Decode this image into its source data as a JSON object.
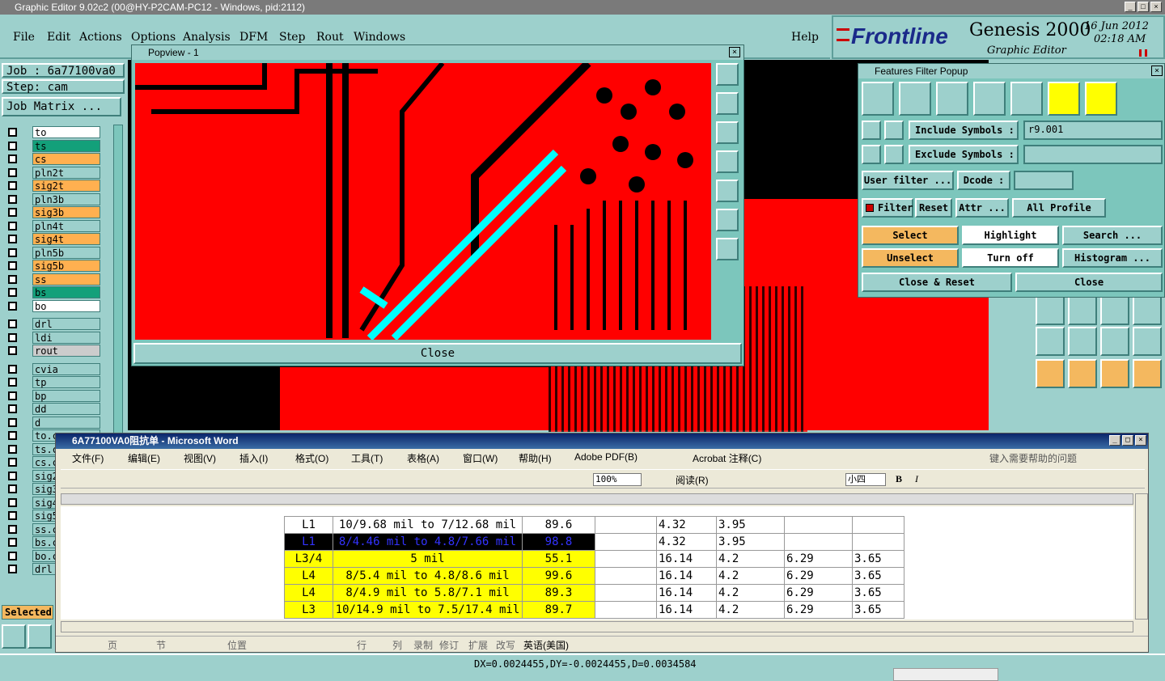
{
  "window": {
    "title": "Graphic Editor 9.02c2 (00@HY-P2CAM-PC12 - Windows, pid:2112)"
  },
  "menu": [
    "File",
    "Edit",
    "Actions",
    "Options",
    "Analysis",
    "DFM",
    "Step",
    "Rout",
    "Windows"
  ],
  "help": "Help",
  "logo": {
    "brand": "Frontline",
    "product": "Genesis 2000",
    "subtitle": "Graphic Editor",
    "date": "16 Jun 2012",
    "time": "02:18 AM"
  },
  "job": {
    "job": "Job : 6a77100va0",
    "step": "Step: cam",
    "matrix": "Job Matrix ..."
  },
  "layers": [
    {
      "name": "to",
      "color": "#ffffff"
    },
    {
      "name": "ts",
      "color": "#13a07a"
    },
    {
      "name": "cs",
      "color": "#ffb050"
    },
    {
      "name": "pln2t",
      "color": "#9dd0cc"
    },
    {
      "name": "sig2t",
      "color": "#ffb050"
    },
    {
      "name": "pln3b",
      "color": "#9dd0cc"
    },
    {
      "name": "sig3b",
      "color": "#ffb050"
    },
    {
      "name": "pln4t",
      "color": "#9dd0cc"
    },
    {
      "name": "sig4t",
      "color": "#ffb050"
    },
    {
      "name": "pln5b",
      "color": "#9dd0cc"
    },
    {
      "name": "sig5b",
      "color": "#ffb050"
    },
    {
      "name": "ss",
      "color": "#ffb050"
    },
    {
      "name": "bs",
      "color": "#13a07a"
    },
    {
      "name": "bo",
      "color": "#ffffff"
    },
    {
      "name": "drl",
      "color": "#9dd0cc"
    },
    {
      "name": "ldi",
      "color": "#9dd0cc"
    },
    {
      "name": "rout",
      "color": "#cccccc"
    },
    {
      "name": "cvia",
      "color": "#9dd0cc"
    },
    {
      "name": "tp",
      "color": "#9dd0cc"
    },
    {
      "name": "bp",
      "color": "#9dd0cc"
    },
    {
      "name": "dd",
      "color": "#9dd0cc"
    },
    {
      "name": "d",
      "color": "#9dd0cc"
    },
    {
      "name": "to.c",
      "color": "#9dd0cc"
    },
    {
      "name": "ts.c",
      "color": "#9dd0cc"
    },
    {
      "name": "cs.c",
      "color": "#9dd0cc"
    },
    {
      "name": "sig2",
      "color": "#9dd0cc"
    },
    {
      "name": "sig3",
      "color": "#9dd0cc"
    },
    {
      "name": "sig4",
      "color": "#9dd0cc"
    },
    {
      "name": "sig5",
      "color": "#9dd0cc"
    },
    {
      "name": "ss.c",
      "color": "#9dd0cc"
    },
    {
      "name": "bs.c",
      "color": "#9dd0cc"
    },
    {
      "name": "bo.c",
      "color": "#9dd0cc"
    },
    {
      "name": "drl",
      "color": "#9dd0cc"
    }
  ],
  "selected_label": "Selected",
  "popview": {
    "title": "Popview - 1",
    "close": "Close"
  },
  "features_filter": {
    "title": "Features Filter Popup",
    "include_label": "Include Symbols :",
    "include_value": "r9.001",
    "exclude_label": "Exclude Symbols :",
    "exclude_value": "",
    "user_filter": "User filter ...",
    "dcode": "Dcode :",
    "filter": "Filter",
    "reset": "Reset",
    "attr": "Attr ...",
    "profile": "All Profile",
    "select": "Select",
    "highlight": "Highlight",
    "search": "Search ...",
    "unselect": "Unselect",
    "turn_off": "Turn off",
    "histogram": "Histogram ...",
    "close_reset": "Close & Reset",
    "close": "Close"
  },
  "word": {
    "title": "6A77100VA0阻抗单 - Microsoft Word",
    "menu": [
      "文件(F)",
      "编辑(E)",
      "视图(V)",
      "插入(I)",
      "格式(O)",
      "工具(T)",
      "表格(A)",
      "窗口(W)",
      "帮助(H)",
      "Adobe PDF(B)",
      "Acrobat 注释(C)"
    ],
    "help_placeholder": "键入需要帮助的问题",
    "zoom": "100%",
    "read": "阅读(R)",
    "fontsize": "小四",
    "rows": [
      [
        "L1",
        "10/9.68 mil to 7/12.68 mil",
        "89.6",
        "4.32",
        "3.95",
        "",
        ""
      ],
      [
        "L1",
        "8/4.46 mil to 4.8/7.66 mil",
        "98.8",
        "4.32",
        "3.95",
        "",
        ""
      ],
      [
        "L3/4",
        "5 mil",
        "55.1",
        "16.14",
        "4.2",
        "6.29",
        "3.65"
      ],
      [
        "L4",
        "8/5.4 mil to 4.8/8.6 mil",
        "99.6",
        "16.14",
        "4.2",
        "6.29",
        "3.65"
      ],
      [
        "L4",
        "8/4.9 mil to 5.8/7.1 mil",
        "89.3",
        "16.14",
        "4.2",
        "6.29",
        "3.65"
      ],
      [
        "L3",
        "10/14.9 mil to 7.5/17.4 mil",
        "89.7",
        "16.14",
        "4.2",
        "6.29",
        "3.65"
      ]
    ],
    "status": [
      "页",
      "节",
      "位置",
      "行",
      "列",
      "录制",
      "修订",
      "扩展",
      "改写",
      "英语(美国)"
    ]
  },
  "coords": "DX=0.0024455,DY=-0.0024455,D=0.0034584"
}
